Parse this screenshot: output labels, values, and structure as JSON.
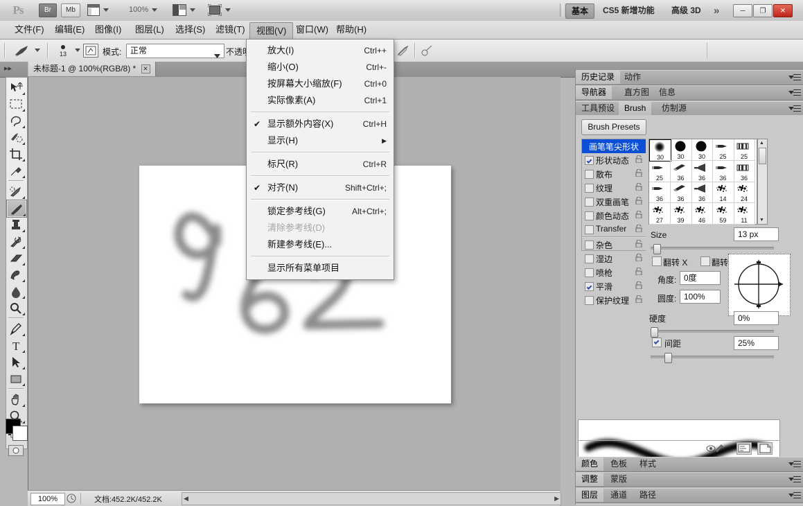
{
  "app": {
    "logo": "Ps",
    "bridge": "Br",
    "minibridge": "Mb",
    "zoom_level": "100%",
    "workspaces": [
      "基本",
      "CS5 新增功能",
      "高级 3D"
    ],
    "workspace_more": "»",
    "window_buttons": {
      "minimize": "─",
      "maximize": "❐",
      "close": "✕"
    }
  },
  "menubar": {
    "items": [
      {
        "label": "文件(F)",
        "open": false
      },
      {
        "label": "编辑(E)",
        "open": false
      },
      {
        "label": "图像(I)",
        "open": false
      },
      {
        "label": "图层(L)",
        "open": false
      },
      {
        "label": "选择(S)",
        "open": false
      },
      {
        "label": "滤镜(T)",
        "open": false
      },
      {
        "label": "视图(V)",
        "open": true
      },
      {
        "label": "窗口(W)",
        "open": false
      },
      {
        "label": "帮助(H)",
        "open": false
      }
    ]
  },
  "view_menu": {
    "groups": [
      {
        "items": [
          {
            "label": "放大(I)",
            "shortcut": "Ctrl++",
            "checked": false,
            "disabled": false,
            "submenu": false
          },
          {
            "label": "缩小(O)",
            "shortcut": "Ctrl+-",
            "checked": false,
            "disabled": false,
            "submenu": false
          },
          {
            "label": "按屏幕大小缩放(F)",
            "shortcut": "Ctrl+0",
            "checked": false,
            "disabled": false,
            "submenu": false
          },
          {
            "label": "实际像素(A)",
            "shortcut": "Ctrl+1",
            "checked": false,
            "disabled": false,
            "submenu": false
          }
        ]
      },
      {
        "items": [
          {
            "label": "显示额外内容(X)",
            "shortcut": "Ctrl+H",
            "checked": true,
            "disabled": false,
            "submenu": false
          },
          {
            "label": "显示(H)",
            "shortcut": "",
            "checked": false,
            "disabled": false,
            "submenu": true
          }
        ]
      },
      {
        "items": [
          {
            "label": "标尺(R)",
            "shortcut": "Ctrl+R",
            "checked": false,
            "disabled": false,
            "submenu": false
          }
        ]
      },
      {
        "items": [
          {
            "label": "对齐(N)",
            "shortcut": "Shift+Ctrl+;",
            "checked": true,
            "disabled": false,
            "submenu": false
          }
        ]
      },
      {
        "items": [
          {
            "label": "锁定参考线(G)",
            "shortcut": "Alt+Ctrl+;",
            "checked": false,
            "disabled": false,
            "submenu": false
          },
          {
            "label": "清除参考线(D)",
            "shortcut": "",
            "checked": false,
            "disabled": true,
            "submenu": false
          },
          {
            "label": "新建参考线(E)...",
            "shortcut": "",
            "checked": false,
            "disabled": false,
            "submenu": false
          }
        ]
      },
      {
        "items": [
          {
            "label": "显示所有菜单项目",
            "shortcut": "",
            "checked": false,
            "disabled": false,
            "submenu": false
          }
        ]
      }
    ]
  },
  "options_bar": {
    "brush_size_badge": "13",
    "mode_label": "模式:",
    "mode_value": "正常",
    "opacity_label": "不透明"
  },
  "document_tab": {
    "title": "未标题-1 @ 100%(RGB/8) *",
    "close": "✕"
  },
  "canvas": {
    "content_description": "962"
  },
  "status_bar": {
    "zoom": "100%",
    "doc_info": "文档:452.2K/452.2K",
    "arrow": "▶"
  },
  "toolbar": {
    "tools": [
      "move-tool",
      "marquee-tool",
      "lasso-tool",
      "quick-select-tool",
      "crop-tool",
      "eyedropper-tool",
      "healing-brush-tool",
      "brush-tool",
      "clone-stamp-tool",
      "history-brush-tool",
      "eraser-tool",
      "gradient-tool",
      "blur-tool",
      "dodge-tool",
      "pen-tool",
      "type-tool",
      "path-select-tool",
      "shape-tool",
      "hand-tool",
      "zoom-tool"
    ],
    "selected": "brush-tool",
    "foreground_color": "#000000",
    "background_color": "#ffffff"
  },
  "dock": {
    "row1_tabs": [
      "历史记录",
      "动作"
    ],
    "row1_active": "历史记录",
    "row2_tabs": [
      "导航器",
      "直方图",
      "信息"
    ],
    "row2_active": "导航器",
    "row3_tabs": [
      "工具预设",
      "Brush",
      "仿制源"
    ],
    "row3_active": "Brush",
    "bottom_rows": [
      {
        "tabs": [
          "颜色",
          "色板",
          "样式"
        ],
        "active": "颜色"
      },
      {
        "tabs": [
          "调整",
          "蒙版"
        ],
        "active": "调整"
      },
      {
        "tabs": [
          "图层",
          "通道",
          "路径"
        ],
        "active": "图层"
      }
    ]
  },
  "brush_panel": {
    "presets_button": "Brush Presets",
    "options": [
      {
        "label": "画笔笔尖形状",
        "checkbox": false,
        "checked": false,
        "selected": true,
        "lock": false,
        "sep_after": false
      },
      {
        "label": "形状动态",
        "checkbox": true,
        "checked": true,
        "selected": false,
        "lock": true,
        "sep_after": false
      },
      {
        "label": "散布",
        "checkbox": true,
        "checked": false,
        "selected": false,
        "lock": true,
        "sep_after": false
      },
      {
        "label": "纹理",
        "checkbox": true,
        "checked": false,
        "selected": false,
        "lock": true,
        "sep_after": false
      },
      {
        "label": "双重画笔",
        "checkbox": true,
        "checked": false,
        "selected": false,
        "lock": true,
        "sep_after": false
      },
      {
        "label": "颜色动态",
        "checkbox": true,
        "checked": false,
        "selected": false,
        "lock": true,
        "sep_after": false
      },
      {
        "label": "Transfer",
        "checkbox": true,
        "checked": false,
        "selected": false,
        "lock": true,
        "sep_after": true
      },
      {
        "label": "杂色",
        "checkbox": true,
        "checked": false,
        "selected": false,
        "lock": true,
        "sep_after": false
      },
      {
        "label": "湿边",
        "checkbox": true,
        "checked": false,
        "selected": false,
        "lock": true,
        "sep_after": false
      },
      {
        "label": "喷枪",
        "checkbox": true,
        "checked": false,
        "selected": false,
        "lock": true,
        "sep_after": false
      },
      {
        "label": "平滑",
        "checkbox": true,
        "checked": true,
        "selected": false,
        "lock": true,
        "sep_after": false
      },
      {
        "label": "保护纹理",
        "checkbox": true,
        "checked": false,
        "selected": false,
        "lock": true,
        "sep_after": false
      }
    ],
    "tip_grid": [
      {
        "num": "30",
        "kind": "soft-round",
        "selected": true
      },
      {
        "num": "30",
        "kind": "hard-round",
        "selected": false
      },
      {
        "num": "30",
        "kind": "hard-round",
        "selected": false
      },
      {
        "num": "25",
        "kind": "flat-tip",
        "selected": false
      },
      {
        "num": "25",
        "kind": "bristle",
        "selected": false
      },
      {
        "num": "25",
        "kind": "flat-tip",
        "selected": false
      },
      {
        "num": "36",
        "kind": "angled",
        "selected": false
      },
      {
        "num": "36",
        "kind": "fan",
        "selected": false
      },
      {
        "num": "36",
        "kind": "flat-tip",
        "selected": false
      },
      {
        "num": "36",
        "kind": "bristle",
        "selected": false
      },
      {
        "num": "36",
        "kind": "flat-tip",
        "selected": false
      },
      {
        "num": "36",
        "kind": "angled",
        "selected": false
      },
      {
        "num": "36",
        "kind": "fan",
        "selected": false
      },
      {
        "num": "14",
        "kind": "spatter",
        "selected": false
      },
      {
        "num": "24",
        "kind": "spatter",
        "selected": false
      },
      {
        "num": "27",
        "kind": "spatter",
        "selected": false
      },
      {
        "num": "39",
        "kind": "spatter",
        "selected": false
      },
      {
        "num": "46",
        "kind": "spatter",
        "selected": false
      },
      {
        "num": "59",
        "kind": "spatter",
        "selected": false
      },
      {
        "num": "11",
        "kind": "spatter",
        "selected": false
      }
    ],
    "size_label": "Size",
    "size_value": "13 px",
    "size_percent": 6,
    "flip_x_label": "翻转 X",
    "flip_x_checked": false,
    "flip_y_label": "翻转 Y",
    "flip_y_checked": false,
    "angle_label": "角度:",
    "angle_value": "0度",
    "roundness_label": "圆度:",
    "roundness_value": "100%",
    "hardness_label": "硬度",
    "hardness_value": "0%",
    "hardness_percent": 0,
    "spacing_label": "间距",
    "spacing_value": "25%",
    "spacing_checked": true,
    "spacing_percent": 11
  }
}
